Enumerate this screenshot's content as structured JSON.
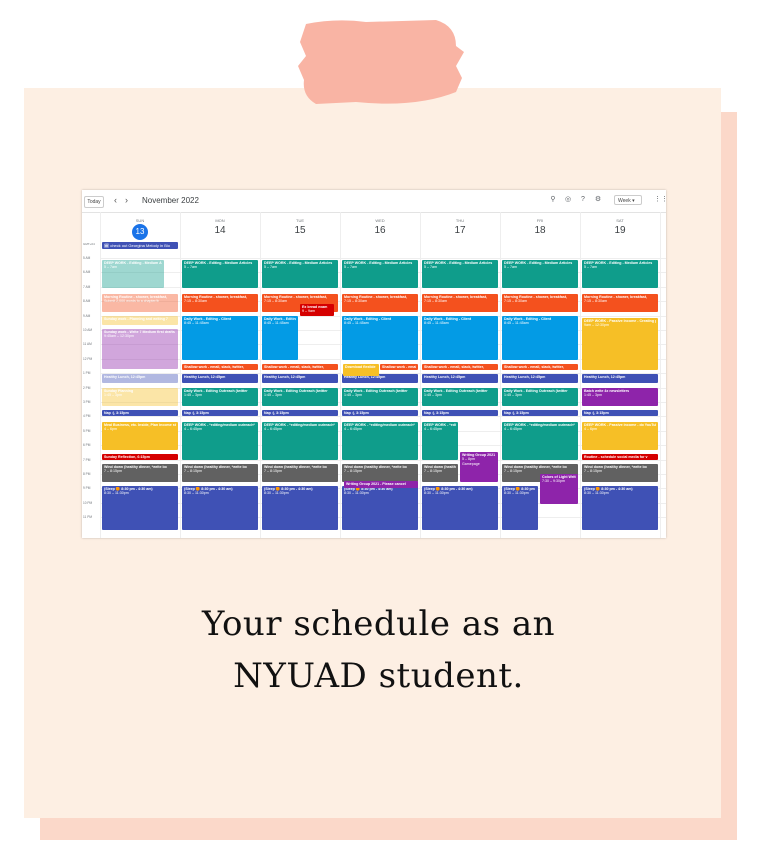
{
  "calendar": {
    "today_label": "Today",
    "prev_icon": "chevron-left-icon",
    "next_icon": "chevron-right-icon",
    "month_label": "November 2022",
    "view_label": "Week",
    "timezone_label": "GMT+04",
    "days": [
      {
        "dow": "SUN",
        "num": "13",
        "today": true
      },
      {
        "dow": "MON",
        "num": "14",
        "today": false
      },
      {
        "dow": "TUE",
        "num": "15",
        "today": false
      },
      {
        "dow": "WED",
        "num": "16",
        "today": false
      },
      {
        "dow": "THU",
        "num": "17",
        "today": false
      },
      {
        "dow": "FRI",
        "num": "18",
        "today": false
      },
      {
        "dow": "SAT",
        "num": "19",
        "today": false
      }
    ],
    "allday_event": "check out Georgina Melody in Bio",
    "hours": [
      "5 AM",
      "6 AM",
      "7 AM",
      "8 AM",
      "9 AM",
      "10 AM",
      "11 AM",
      "12 PM",
      "1 PM",
      "2 PM",
      "3 PM",
      "4 PM",
      "5 PM",
      "6 PM",
      "7 PM",
      "8 PM",
      "9 PM",
      "10 PM",
      "11 PM"
    ],
    "events": {
      "deep_work_title": "DEEP WORK - Editing - Medium Articles",
      "deep_work_time": "5 – 7am",
      "skipped": "Skipped · Everyday",
      "morning_title": "Morning Routine - shower, breakfast,",
      "morning_time": "7:15 – 8:30am",
      "daily_work_title": "Daily Work - Editing - Client",
      "daily_work_time": "8:45 – 11:45am",
      "sunday_work": "Sunday work - Planning and writing 7",
      "sunday_work2": "Submit 2,000 words to a chapter/b",
      "sunday_writing": "Sunday work - Write 7 Medium first drafts",
      "sunday_writing_time": "9:45am – 12:30pm",
      "ex_exam_title": "Ex bread exam",
      "ex_exam_time": "9 – 9am",
      "passive_title": "DEEP WORK - Passive income - Creating products/lessons",
      "passive_time": "9am – 12:30pm",
      "shallow_title": "Shallow work - email, slack, twitter,",
      "download_title": "Download flexible",
      "lunch": "Healthy Lunch, 12:45pm",
      "outreach_title": "Daily Work - Editing Outreach (twitter",
      "outreach_time": "1:45 – 3pm",
      "sunday_planning": "Sunday Planning",
      "sunday_planning_time": "1:45 – 3pm",
      "batch_title": "Batch write 4x newsletters",
      "batch_time": "1:45 – 3pm",
      "nap": "Nap :), 3:15pm",
      "deep_outreach_title": "DEEP WORK - *editing/medium outreach*",
      "deep_outreach_time": "4 – 6:45pm",
      "meal_title": "Meal Business, etc. Inside, Plan income strategies",
      "meal_time": "4 – 6pm",
      "passive_youtube": "DEEP WORK - Passive income - do YouTube content",
      "passive_youtube_time": "4 – 6pm",
      "sunday_reflection": "Sunday Reflection, 6:15pm",
      "schedule_social": "Routine - schedule social media for v",
      "wind_title": "Wind down (healthy dinner, *write bo",
      "wind_time": "7 – 8:15pm",
      "writing_group_title": "Writing Group 2021 - Hey! We're",
      "writing_group_time": "5 – 8pm",
      "writing_group_place": "Gamepage",
      "writing_group_2021": "Writing Group 2021 - Please cancel",
      "colors_title": "Colors of Light Writing Group",
      "colors_time": "7:30 – 9:30pm",
      "sleep_title": "(Sleep 🟠 8:30 pm - 4:30 am)",
      "sleep_time": "8:30 – 11:30pm"
    }
  },
  "caption": {
    "line1": "Your schedule as an",
    "line2": "NYUAD student."
  },
  "colors": {
    "note_bg": "#fdefe3",
    "note_shadow": "#fbd8c9",
    "tape": "#f9b4a4",
    "today_blue": "#1a73e8"
  }
}
